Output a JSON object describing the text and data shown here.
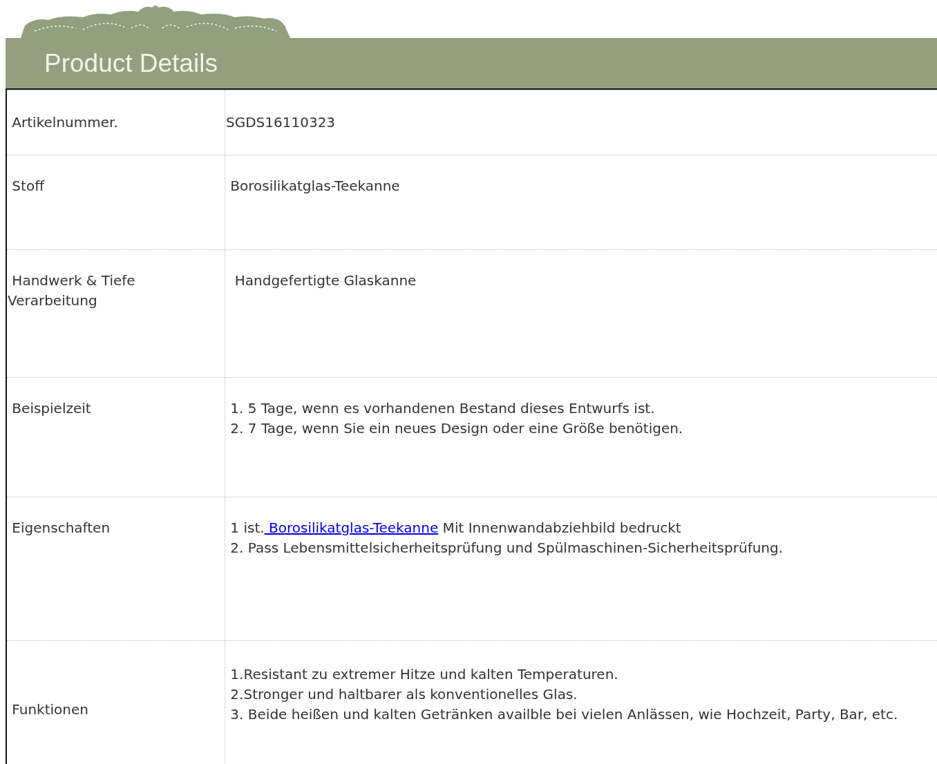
{
  "header": {
    "title": "Product Details"
  },
  "rows": [
    {
      "label": " Artikelnummer.",
      "lines": [
        {
          "text": "SGDS16110323"
        }
      ]
    },
    {
      "label": " Stoff",
      "lines": [
        {
          "text": " Borosilikatglas-Teekanne"
        }
      ]
    },
    {
      "label": " Handwerk & Tiefe Verarbeitung",
      "lines": [
        {
          "text": "  Handgefertigte Glaskanne"
        }
      ]
    },
    {
      "label": " Beispielzeit",
      "lines": [
        {
          "text": " 1. 5 Tage, wenn es vorhandenen Bestand dieses Entwurfs ist."
        },
        {
          "text": " 2. 7 Tage, wenn Sie ein neues Design oder eine Größe benötigen."
        }
      ]
    },
    {
      "label": " Eigenschaften",
      "lines": [
        {
          "text": " 1 ist.",
          "link": " Borosilikatglas-Teekanne",
          "after": " Mit Innenwandabziehbild bedruckt"
        },
        {
          "text": " 2. Pass Lebensmittelsicherheitsprüfung und Spülmaschinen-Sicherheitsprüfung."
        }
      ]
    },
    {
      "label": " Funktionen",
      "lines": [
        {
          "text": " 1.Resistant zu extremer Hitze und kalten Temperaturen."
        },
        {
          "text": " 2.Stronger und haltbarer als konventionelles Glas."
        },
        {
          "text": " 3. Beide heißen und kalten Getränken availble bei vielen Anlässen, wie Hochzeit, Party, Bar, etc."
        }
      ]
    }
  ]
}
